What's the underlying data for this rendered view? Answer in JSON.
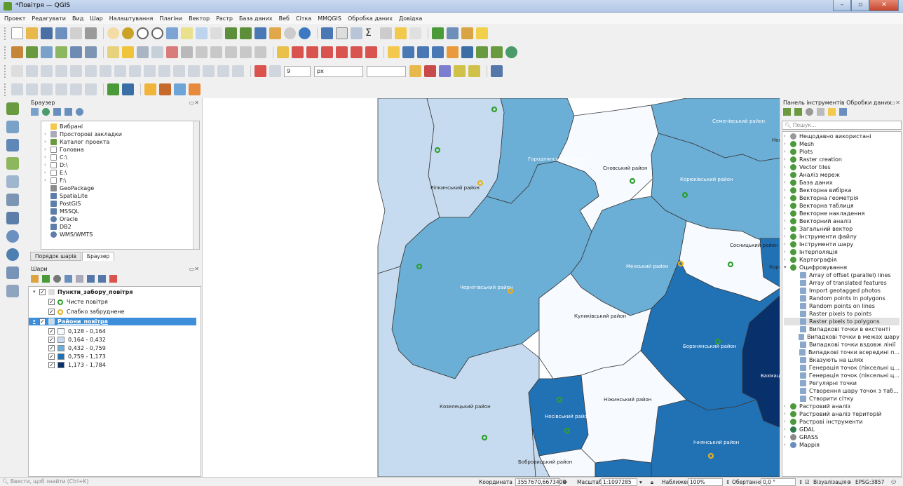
{
  "window": {
    "title": "*Повітря — QGIS"
  },
  "menu": [
    "Проект",
    "Редагувати",
    "Вид",
    "Шар",
    "Налаштування",
    "Плагіни",
    "Вектор",
    "Растр",
    "База даних",
    "Веб",
    "Сітка",
    "MMQGIS",
    "Обробка даних",
    "Довідка"
  ],
  "toolbar": {
    "size_value": "9",
    "unit_value": "px"
  },
  "browser": {
    "title": "Браузер",
    "items": [
      "Вибрані",
      "Просторові закладки",
      "Каталог проекта",
      "Головна",
      "C:\\",
      "D:\\",
      "E:\\",
      "F:\\",
      "GeoPackage",
      "SpatiaLite",
      "PostGIS",
      "MSSQL",
      "Oracle",
      "DB2",
      "WMS/WMTS"
    ]
  },
  "tabs": [
    "Порядок шарів",
    "Браузер"
  ],
  "layers": {
    "title": "Шари",
    "group1": "Пункти_забору_повітря",
    "legend1": [
      "Чисте повітря",
      "Слабко забруднене"
    ],
    "group2": "Райони_повітря",
    "classes": [
      {
        "label": "0,128 - 0,164",
        "color": "#f7fbff"
      },
      {
        "label": "0,164 - 0,432",
        "color": "#c6dbef"
      },
      {
        "label": "0,432 - 0,759",
        "color": "#6baed6"
      },
      {
        "label": "0,759 - 1,173",
        "color": "#2171b5"
      },
      {
        "label": "1,173 - 1,784",
        "color": "#08306b"
      }
    ]
  },
  "map": {
    "labels": [
      "Семенівський район",
      "Городнянський район",
      "Сновський район",
      "Корюківський район",
      "Ріпкинський район",
      "Сосницький район",
      "Менський район",
      "Чернігівський район",
      "Куликівський район",
      "Борзнянський район",
      "Бахмац",
      "Козелецький район",
      "Носівський район",
      "Ніжинський район",
      "Ічнянський район",
      "Бобровицький район",
      "Коро",
      "Нов"
    ]
  },
  "processing": {
    "title": "Панель інструментів Обробки даних",
    "search_placeholder": "Пошук...",
    "groups_top": [
      "Нещодавно використані",
      "Mesh",
      "Plots",
      "Raster creation",
      "Vector tiles",
      "Аналіз мереж",
      "База даних",
      "Векторна вибірка",
      "Векторна геометрія",
      "Векторна таблиця",
      "Векторне накладення",
      "Векторний аналіз",
      "Загальний вектор",
      "Інструменти файлу",
      "Інструменти шару",
      "Інтерполяція",
      "Картографія",
      "Оцифровування"
    ],
    "digitize_items": [
      "Array of offset (parallel) lines",
      "Array of translated features",
      "Import geotagged photos",
      "Random points in polygons",
      "Random points on lines",
      "Raster pixels to points",
      "Raster pixels to polygons",
      "Випадкові точки в екстенті",
      "Випадкові точки в межах шару",
      "Випадкові точки вздовж лінії",
      "Випадкові точки всередині п...",
      "Вказують на шлях",
      "Генерація точок (піксельні ц...",
      "Генерація точок (піксельні ц...",
      "Регулярні точки",
      "Створення шару точок з таб...",
      "Створити сітку"
    ],
    "groups_bottom": [
      "Растровий аналіз",
      "Растровий аналіз територій",
      "Растрові інструменти",
      "GDAL",
      "GRASS",
      "Маррія"
    ]
  },
  "status": {
    "search_placeholder": "Ввести, щоб знайти (Ctrl+K)",
    "coord_label": "Координата",
    "coord_value": "3557670,6673400",
    "scale_label": "Масштаб",
    "scale_value": "1:1097285",
    "zoom_label": "Наближення",
    "zoom_value": "100%",
    "rotation_label": "Обертання",
    "rotation_value": "0,0 °",
    "render_label": "Візуалізація",
    "crs": "EPSG:3857"
  }
}
